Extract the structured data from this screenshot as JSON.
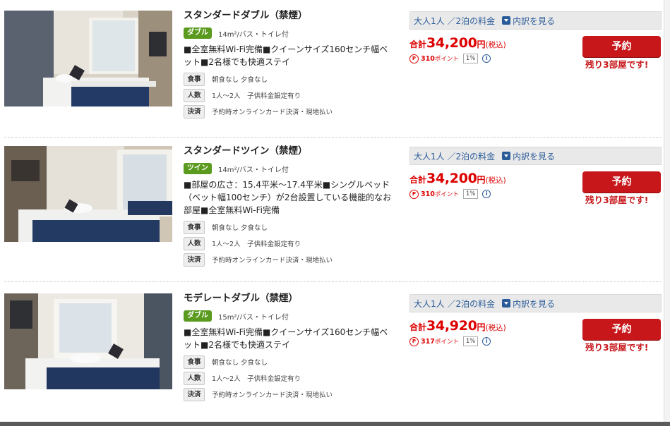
{
  "rooms": [
    {
      "name": "スタンダードダブル（禁煙）",
      "type": "ダブル",
      "size": "14m²/バス・トイレ付",
      "desc": "■全室無料Wi-Fi完備■クイーンサイズ160センチ幅ベット■2名様でも快適ステイ",
      "meal_label": "食事",
      "meal": "朝食なし 夕食なし",
      "people_label": "人数",
      "people": "1人～2人　子供料金設定有り",
      "pay_label": "決済",
      "pay": "予約時オンラインカード決済・現地払い",
      "rate": "大人1人 ／2泊の料金",
      "detail": "内訳を見る",
      "total_label": "合計",
      "price": "34,200",
      "yen": "円",
      "tax": "(税込)",
      "points": "310",
      "points_label": "ポイント",
      "pct": "1%",
      "book": "予約",
      "left": "残り3部屋です!"
    },
    {
      "name": "スタンダードツイン（禁煙）",
      "type": "ツイン",
      "size": "14m²/バス・トイレ付",
      "desc": "■部屋の広さ：15.4平米～17.4平米■シングルベッド（ベット幅100センチ）が2台設置している機能的なお部屋■全室無料Wi-Fi完備",
      "meal_label": "食事",
      "meal": "朝食なし 夕食なし",
      "people_label": "人数",
      "people": "1人～2人　子供料金設定有り",
      "pay_label": "決済",
      "pay": "予約時オンラインカード決済・現地払い",
      "rate": "大人1人 ／2泊の料金",
      "detail": "内訳を見る",
      "total_label": "合計",
      "price": "34,200",
      "yen": "円",
      "tax": "(税込)",
      "points": "310",
      "points_label": "ポイント",
      "pct": "1%",
      "book": "予約",
      "left": "残り3部屋です!"
    },
    {
      "name": "モデレートダブル（禁煙）",
      "type": "ダブル",
      "size": "15m²/バス・トイレ付",
      "desc": "■全室無料Wi-Fi完備■クイーンサイズ160センチ幅ベット■2名様でも快適ステイ",
      "meal_label": "食事",
      "meal": "朝食なし 夕食なし",
      "people_label": "人数",
      "people": "1人～2人　子供料金設定有り",
      "pay_label": "決済",
      "pay": "予約時オンラインカード決済・現地払い",
      "rate": "大人1人 ／2泊の料金",
      "detail": "内訳を見る",
      "total_label": "合計",
      "price": "34,920",
      "yen": "円",
      "tax": "(税込)",
      "points": "317",
      "points_label": "ポイント",
      "pct": "1%",
      "book": "予約",
      "left": "残り3部屋です!"
    }
  ],
  "colors": {
    "accent_red": "#c7171b",
    "price_red": "#dd0000",
    "type_green": "#5a9a1e",
    "link_blue": "#2b5c9a"
  },
  "icons": {
    "detail": "chevron-down-icon",
    "points": "point-icon",
    "info": "info-icon"
  }
}
